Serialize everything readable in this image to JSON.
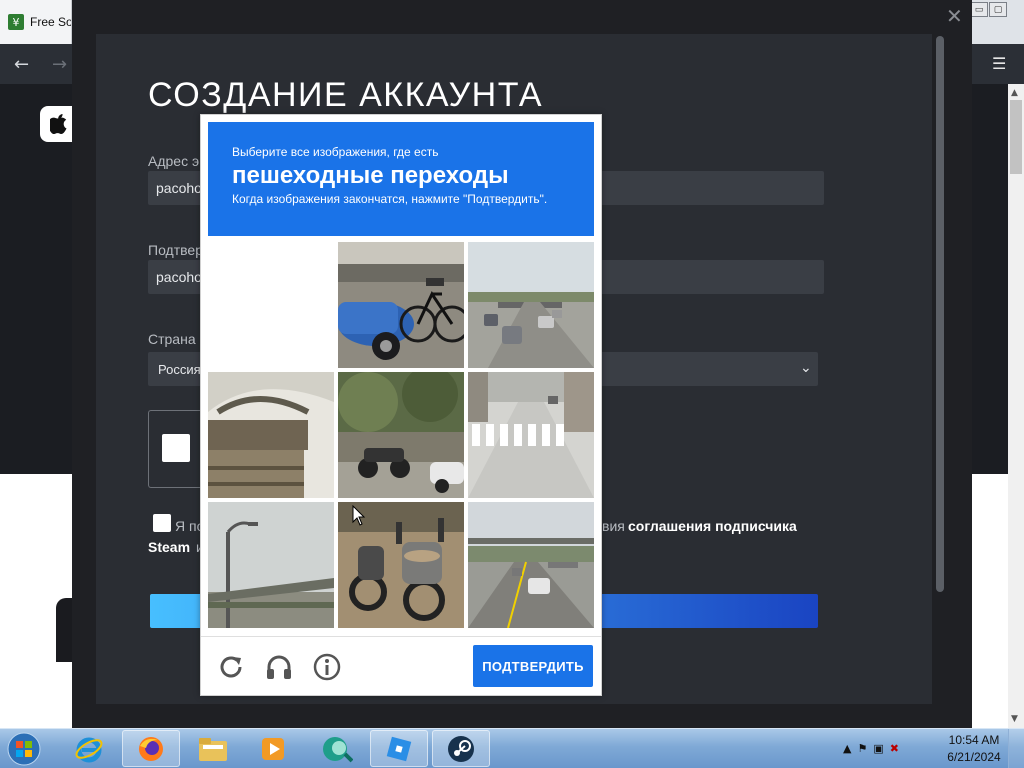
{
  "browser": {
    "tab_title": "Free Sot",
    "favicon_glyph": "¥",
    "nav_back_icon": "arrow-left-icon",
    "nav_forward_icon": "arrow-right-icon",
    "menu_icon": "hamburger-menu-icon",
    "window_controls": [
      "▭",
      "▢"
    ]
  },
  "overlay": {
    "close_glyph": "✕"
  },
  "form": {
    "title": "СОЗДАНИЕ АККАУНТА",
    "email_label": "Адрес э",
    "email_value": "pacoho",
    "confirm_label": "Подтвер",
    "confirm_value": "pacoho",
    "country_label": "Страна",
    "country_value": "Россия",
    "agree_pre": "Я по",
    "agree_post": "вия",
    "agree_link": "соглашения подписчика",
    "agree_line2_bold": "Steam",
    "agree_line2_tail": "и"
  },
  "captcha": {
    "instruction_line1": "Выберите все изображения, где есть",
    "target": "пешеходные переходы",
    "instruction_line3": "Когда изображения закончатся, нажмите \"Подтвердить\".",
    "verify_label": "ПОДТВЕРДИТЬ",
    "tiles": [
      {
        "subject": "blank"
      },
      {
        "subject": "blue-car-and-bicycle"
      },
      {
        "subject": "highway-traffic"
      },
      {
        "subject": "stone-bridge"
      },
      {
        "subject": "motorcycles-and-tree"
      },
      {
        "subject": "crosswalk"
      },
      {
        "subject": "street-lamp-overpass"
      },
      {
        "subject": "parked-motorcycles"
      },
      {
        "subject": "highway-overpass"
      }
    ],
    "footer_icons": [
      "reload-icon",
      "headphones-icon",
      "info-icon"
    ]
  },
  "taskbar": {
    "items": [
      "internet-explorer",
      "firefox",
      "file-explorer",
      "media-player",
      "browser-app",
      "roblox",
      "steam"
    ],
    "active": [
      1,
      5,
      6
    ],
    "time": "10:54 AM",
    "date": "6/21/2024"
  },
  "colors": {
    "captcha_blue": "#1a73e8",
    "steam_dark": "#2a2d33",
    "taskbar": "#7fa9d6"
  }
}
